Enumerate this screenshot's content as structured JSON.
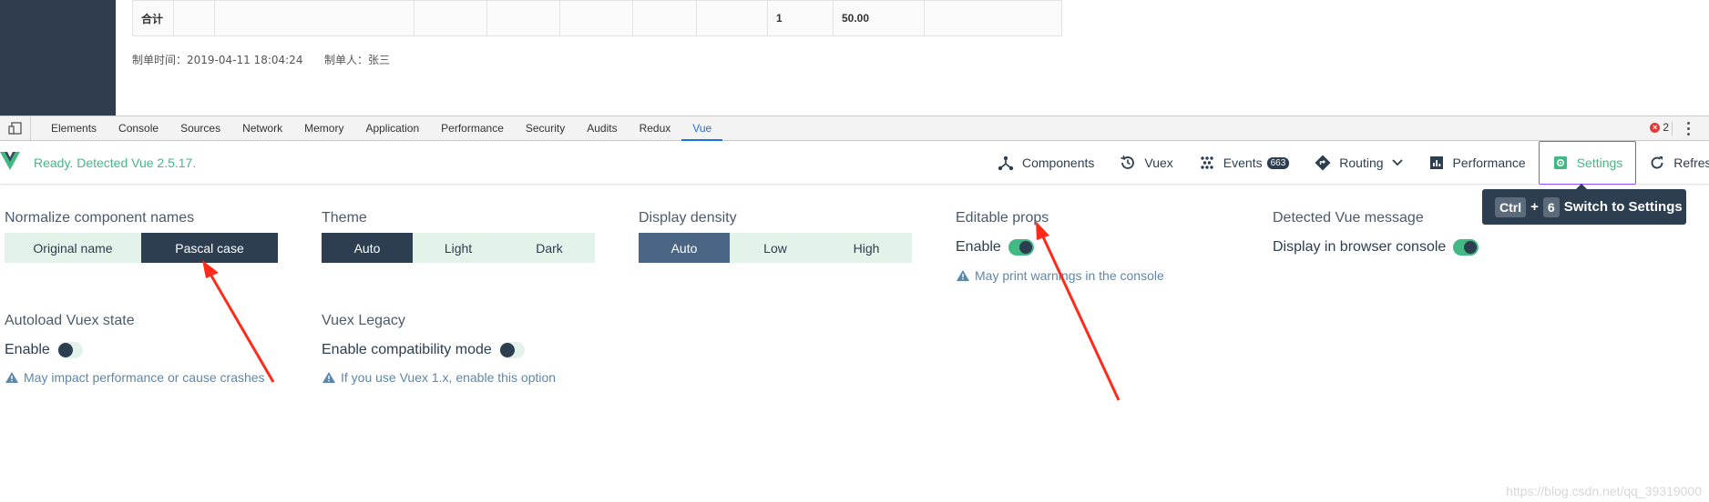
{
  "page": {
    "table_total_label": "合计",
    "table_qty": "1",
    "table_amount": "50.00",
    "footer_time": "制单时间：2019-04-11 18:04:24",
    "footer_maker": "制单人：张三"
  },
  "devtools": {
    "tabs": [
      "Elements",
      "Console",
      "Sources",
      "Network",
      "Memory",
      "Application",
      "Performance",
      "Security",
      "Audits",
      "Redux",
      "Vue"
    ],
    "active_tab": "Vue",
    "error_count": "2"
  },
  "vue": {
    "status": "Ready. Detected Vue 2.5.17.",
    "nav": {
      "components": "Components",
      "vuex": "Vuex",
      "events": "Events",
      "events_count": "663",
      "routing": "Routing",
      "performance": "Performance",
      "settings": "Settings",
      "refresh": "Refres"
    },
    "tooltip": {
      "key1": "Ctrl",
      "plus": "+",
      "key2": "6",
      "text": "Switch to Settings"
    }
  },
  "settings": {
    "normalize": {
      "title": "Normalize component names",
      "options": [
        "Original name",
        "Pascal case"
      ],
      "selected": "Pascal case"
    },
    "theme": {
      "title": "Theme",
      "options": [
        "Auto",
        "Light",
        "Dark"
      ],
      "selected": "Auto"
    },
    "density": {
      "title": "Display density",
      "options": [
        "Auto",
        "Low",
        "High"
      ],
      "selected": "Auto"
    },
    "editable_props": {
      "title": "Editable props",
      "toggle_label": "Enable",
      "enabled": true,
      "note": "May print warnings in the console"
    },
    "detected_msg": {
      "title": "Detected Vue message",
      "toggle_label": "Display in browser console",
      "enabled": true
    },
    "autoload_vuex": {
      "title": "Autoload Vuex state",
      "toggle_label": "Enable",
      "enabled": false,
      "note": "May impact performance or cause crashes"
    },
    "vuex_legacy": {
      "title": "Vuex Legacy",
      "toggle_label": "Enable compatibility mode",
      "enabled": false,
      "note": "If you use Vuex 1.x, enable this option"
    }
  },
  "watermark": "https://blog.csdn.net/qq_39319000",
  "colors": {
    "vue_green": "#42b983",
    "dark": "#2c3e50",
    "light_btn": "#e3f3ea",
    "density_selected": "#4b6584",
    "arrow": "#ff2a1a"
  }
}
